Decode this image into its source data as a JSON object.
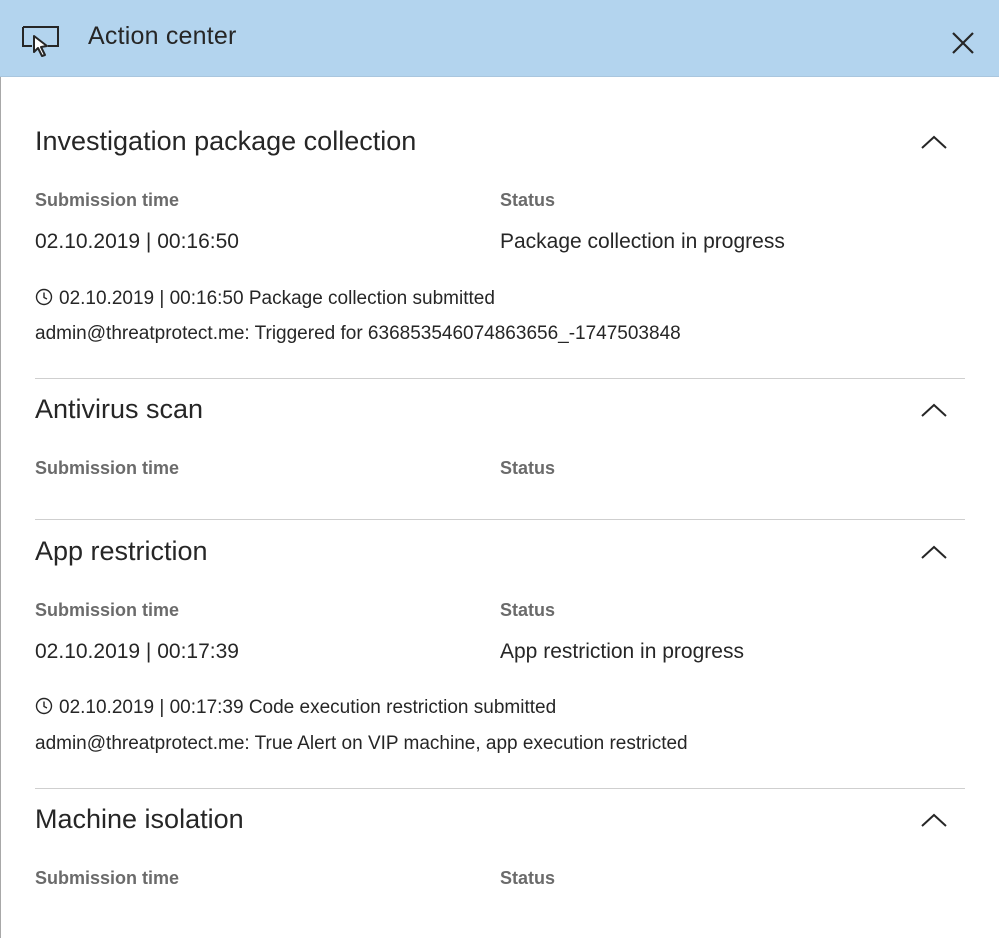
{
  "header": {
    "title": "Action center",
    "panel_icon": "panel-cursor-icon",
    "close_icon": "close-icon"
  },
  "labels": {
    "submission_time": "Submission time",
    "status": "Status"
  },
  "sections": [
    {
      "title": "Investigation package collection",
      "submission_time": "02.10.2019 | 00:16:50",
      "status": "Package collection in progress",
      "log_entry": "02.10.2019 | 00:16:50 Package collection submitted",
      "log_detail": "admin@threatprotect.me: Triggered for 636853546074863656_-1747503848"
    },
    {
      "title": "Antivirus scan"
    },
    {
      "title": "App restriction",
      "submission_time": "02.10.2019 | 00:17:39",
      "status": "App restriction in progress",
      "log_entry": "02.10.2019 | 00:17:39 Code execution restriction submitted",
      "log_detail": "admin@threatprotect.me: True Alert on VIP machine, app execution restricted"
    },
    {
      "title": "Machine isolation"
    }
  ],
  "colors": {
    "header_bg": "#b3d4ee",
    "column_header": "#6b6b6b",
    "divider": "#cfcfcf"
  }
}
